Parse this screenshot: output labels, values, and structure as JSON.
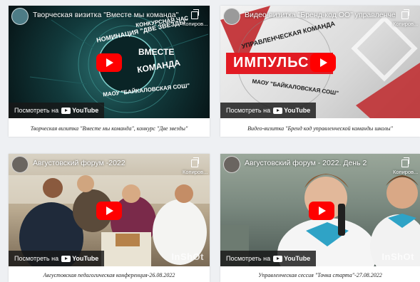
{
  "videos": [
    {
      "title": "Творческая визитка \"Вместе мы команда\"",
      "copy_label": "Копиров...",
      "watch_label": "Посмотреть на",
      "youtube_label": "YouTube",
      "thumb_text_top": "КОНКУРСНАЯ ЧАС",
      "thumb_text_nom": "НОМИНАЦИЯ \"ДВЕ ЗВЕЗДЫ\"",
      "thumb_text_main1": "ВМЕСТЕ",
      "thumb_text_main2": "КОМАНДА",
      "thumb_text_bottom": "МАОУ \"БАЙКАЛОВСКАЯ СОШ\"",
      "caption": "Творческая визитка \"Вместе мы команда\", конкурс \"Две звезды\""
    },
    {
      "title": "Видео-визитка \"Бренд-код ОО\" управленчес...",
      "copy_label": "Копиров...",
      "watch_label": "Посмотреть на",
      "youtube_label": "YouTube",
      "thumb_text_top": "УПРАВЛЕНЧЕСКАЯ КОМАНДА",
      "thumb_text_main1": "ИМПУЛЬС",
      "thumb_text_bottom": "МАОУ \"БАЙКАЛОВСКАЯ СОШ\"",
      "caption": "Видео-визитка \"Бренд код управленческой команды школы\""
    },
    {
      "title": "Августовский форум -2022",
      "copy_label": "Копиров...",
      "watch_label": "Посмотреть на",
      "youtube_label": "YouTube",
      "watermark": "InShOt",
      "caption": "Августовская педагогическая конференция-26.08.2022"
    },
    {
      "title": "Августовский форум - 2022. День 2",
      "copy_label": "Копиров...",
      "watch_label": "Посмотреть на",
      "youtube_label": "YouTube",
      "watermark": "InShOt",
      "caption": "Управленческая сессия \"Точка старта\"-27.08.2022"
    }
  ],
  "colors": {
    "youtube_red": "#ff0000",
    "page_bg": "#eef0f3"
  }
}
